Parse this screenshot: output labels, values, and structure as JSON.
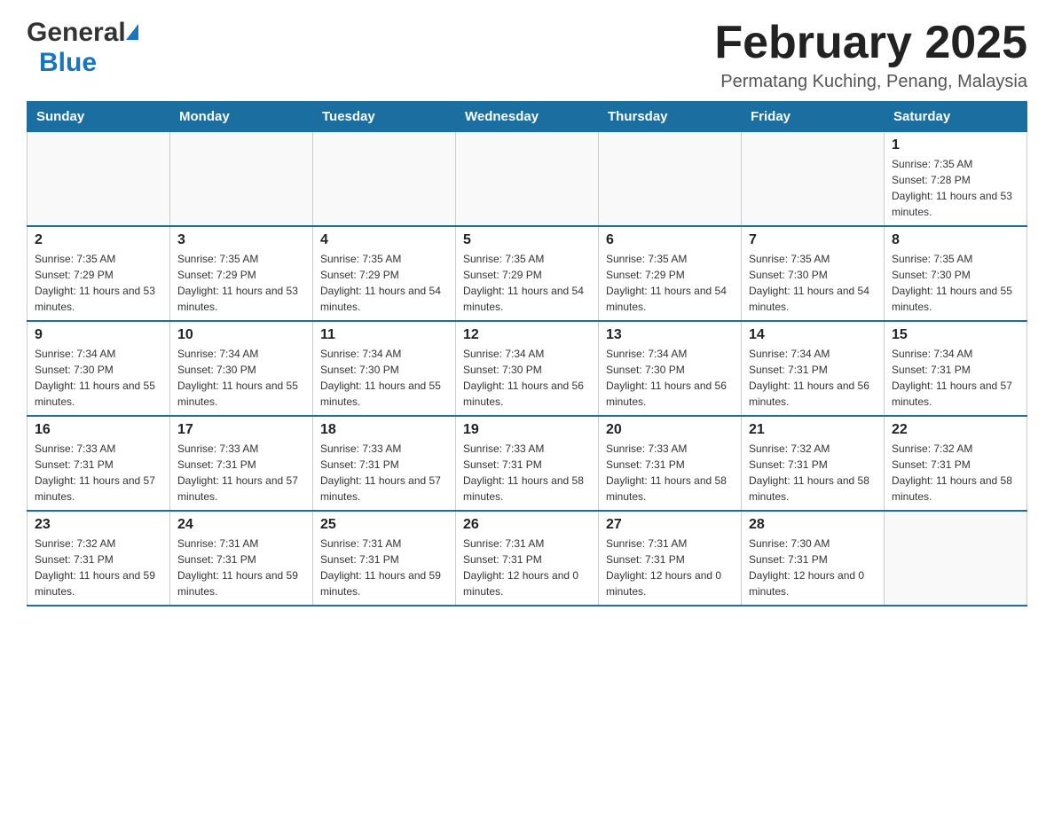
{
  "header": {
    "logo": {
      "general": "General",
      "blue": "Blue"
    },
    "title": "February 2025",
    "location": "Permatang Kuching, Penang, Malaysia"
  },
  "days_of_week": [
    "Sunday",
    "Monday",
    "Tuesday",
    "Wednesday",
    "Thursday",
    "Friday",
    "Saturday"
  ],
  "weeks": [
    {
      "days": [
        {
          "number": "",
          "info": ""
        },
        {
          "number": "",
          "info": ""
        },
        {
          "number": "",
          "info": ""
        },
        {
          "number": "",
          "info": ""
        },
        {
          "number": "",
          "info": ""
        },
        {
          "number": "",
          "info": ""
        },
        {
          "number": "1",
          "info": "Sunrise: 7:35 AM\nSunset: 7:28 PM\nDaylight: 11 hours and 53 minutes."
        }
      ]
    },
    {
      "days": [
        {
          "number": "2",
          "info": "Sunrise: 7:35 AM\nSunset: 7:29 PM\nDaylight: 11 hours and 53 minutes."
        },
        {
          "number": "3",
          "info": "Sunrise: 7:35 AM\nSunset: 7:29 PM\nDaylight: 11 hours and 53 minutes."
        },
        {
          "number": "4",
          "info": "Sunrise: 7:35 AM\nSunset: 7:29 PM\nDaylight: 11 hours and 54 minutes."
        },
        {
          "number": "5",
          "info": "Sunrise: 7:35 AM\nSunset: 7:29 PM\nDaylight: 11 hours and 54 minutes."
        },
        {
          "number": "6",
          "info": "Sunrise: 7:35 AM\nSunset: 7:29 PM\nDaylight: 11 hours and 54 minutes."
        },
        {
          "number": "7",
          "info": "Sunrise: 7:35 AM\nSunset: 7:30 PM\nDaylight: 11 hours and 54 minutes."
        },
        {
          "number": "8",
          "info": "Sunrise: 7:35 AM\nSunset: 7:30 PM\nDaylight: 11 hours and 55 minutes."
        }
      ]
    },
    {
      "days": [
        {
          "number": "9",
          "info": "Sunrise: 7:34 AM\nSunset: 7:30 PM\nDaylight: 11 hours and 55 minutes."
        },
        {
          "number": "10",
          "info": "Sunrise: 7:34 AM\nSunset: 7:30 PM\nDaylight: 11 hours and 55 minutes."
        },
        {
          "number": "11",
          "info": "Sunrise: 7:34 AM\nSunset: 7:30 PM\nDaylight: 11 hours and 55 minutes."
        },
        {
          "number": "12",
          "info": "Sunrise: 7:34 AM\nSunset: 7:30 PM\nDaylight: 11 hours and 56 minutes."
        },
        {
          "number": "13",
          "info": "Sunrise: 7:34 AM\nSunset: 7:30 PM\nDaylight: 11 hours and 56 minutes."
        },
        {
          "number": "14",
          "info": "Sunrise: 7:34 AM\nSunset: 7:31 PM\nDaylight: 11 hours and 56 minutes."
        },
        {
          "number": "15",
          "info": "Sunrise: 7:34 AM\nSunset: 7:31 PM\nDaylight: 11 hours and 57 minutes."
        }
      ]
    },
    {
      "days": [
        {
          "number": "16",
          "info": "Sunrise: 7:33 AM\nSunset: 7:31 PM\nDaylight: 11 hours and 57 minutes."
        },
        {
          "number": "17",
          "info": "Sunrise: 7:33 AM\nSunset: 7:31 PM\nDaylight: 11 hours and 57 minutes."
        },
        {
          "number": "18",
          "info": "Sunrise: 7:33 AM\nSunset: 7:31 PM\nDaylight: 11 hours and 57 minutes."
        },
        {
          "number": "19",
          "info": "Sunrise: 7:33 AM\nSunset: 7:31 PM\nDaylight: 11 hours and 58 minutes."
        },
        {
          "number": "20",
          "info": "Sunrise: 7:33 AM\nSunset: 7:31 PM\nDaylight: 11 hours and 58 minutes."
        },
        {
          "number": "21",
          "info": "Sunrise: 7:32 AM\nSunset: 7:31 PM\nDaylight: 11 hours and 58 minutes."
        },
        {
          "number": "22",
          "info": "Sunrise: 7:32 AM\nSunset: 7:31 PM\nDaylight: 11 hours and 58 minutes."
        }
      ]
    },
    {
      "days": [
        {
          "number": "23",
          "info": "Sunrise: 7:32 AM\nSunset: 7:31 PM\nDaylight: 11 hours and 59 minutes."
        },
        {
          "number": "24",
          "info": "Sunrise: 7:31 AM\nSunset: 7:31 PM\nDaylight: 11 hours and 59 minutes."
        },
        {
          "number": "25",
          "info": "Sunrise: 7:31 AM\nSunset: 7:31 PM\nDaylight: 11 hours and 59 minutes."
        },
        {
          "number": "26",
          "info": "Sunrise: 7:31 AM\nSunset: 7:31 PM\nDaylight: 12 hours and 0 minutes."
        },
        {
          "number": "27",
          "info": "Sunrise: 7:31 AM\nSunset: 7:31 PM\nDaylight: 12 hours and 0 minutes."
        },
        {
          "number": "28",
          "info": "Sunrise: 7:30 AM\nSunset: 7:31 PM\nDaylight: 12 hours and 0 minutes."
        },
        {
          "number": "",
          "info": ""
        }
      ]
    }
  ]
}
